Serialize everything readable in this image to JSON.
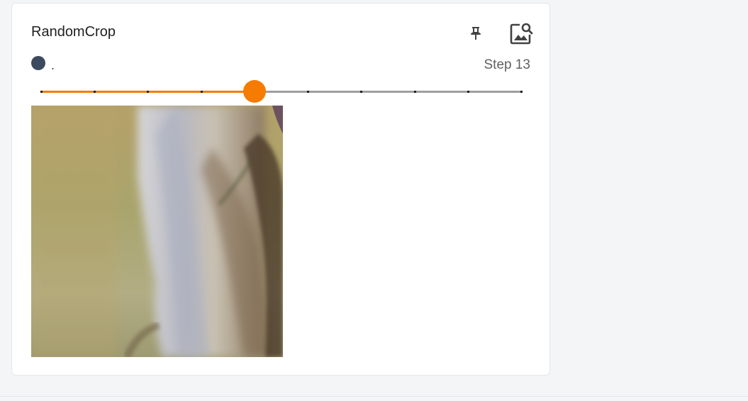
{
  "card": {
    "title": "RandomCrop",
    "run_name": ".",
    "run_color": "#3b4a5e",
    "step_label": "Step 13",
    "pin_icon": "pin-icon",
    "fullscreen_icon": "image-search-icon"
  },
  "slider": {
    "steps": 10,
    "selected_index": 4,
    "accent_color": "#f57c00"
  },
  "image": {
    "alt": "Random crop of an animal's fur"
  }
}
